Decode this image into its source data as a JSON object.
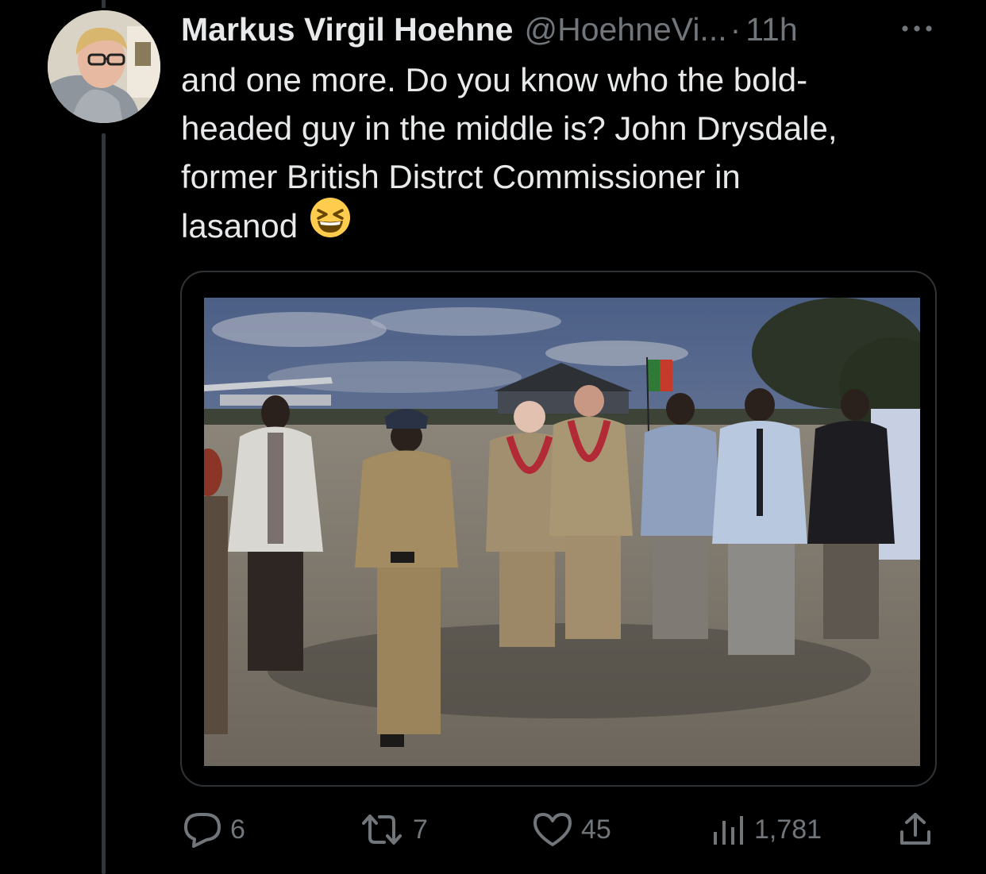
{
  "tweet": {
    "author": {
      "display_name": "Markus Virgil Hoehne",
      "handle": "@HoehneVi...",
      "avatar_icon": "avatar-photo"
    },
    "separator": "·",
    "timestamp": "11h",
    "text_lines": [
      "and one more. Do you know who the bold-",
      "headed guy in the middle is? John Drysdale,",
      "former British Distrct Commissioner in",
      "lasanod"
    ],
    "emoji_icon": "grinning-squinting-face-emoji",
    "media": {
      "type": "photo",
      "icon": "photo"
    },
    "metrics": {
      "replies": "6",
      "retweets": "7",
      "likes": "45",
      "views": "1,781"
    }
  },
  "icons": {
    "more": "more-icon",
    "reply": "reply-icon",
    "retweet": "retweet-icon",
    "like": "heart-icon",
    "views": "views-chart-icon",
    "share": "share-icon"
  },
  "colors": {
    "background": "#000000",
    "text": "#e7e9ea",
    "secondary_text": "#71767b",
    "border": "#2f3336"
  }
}
